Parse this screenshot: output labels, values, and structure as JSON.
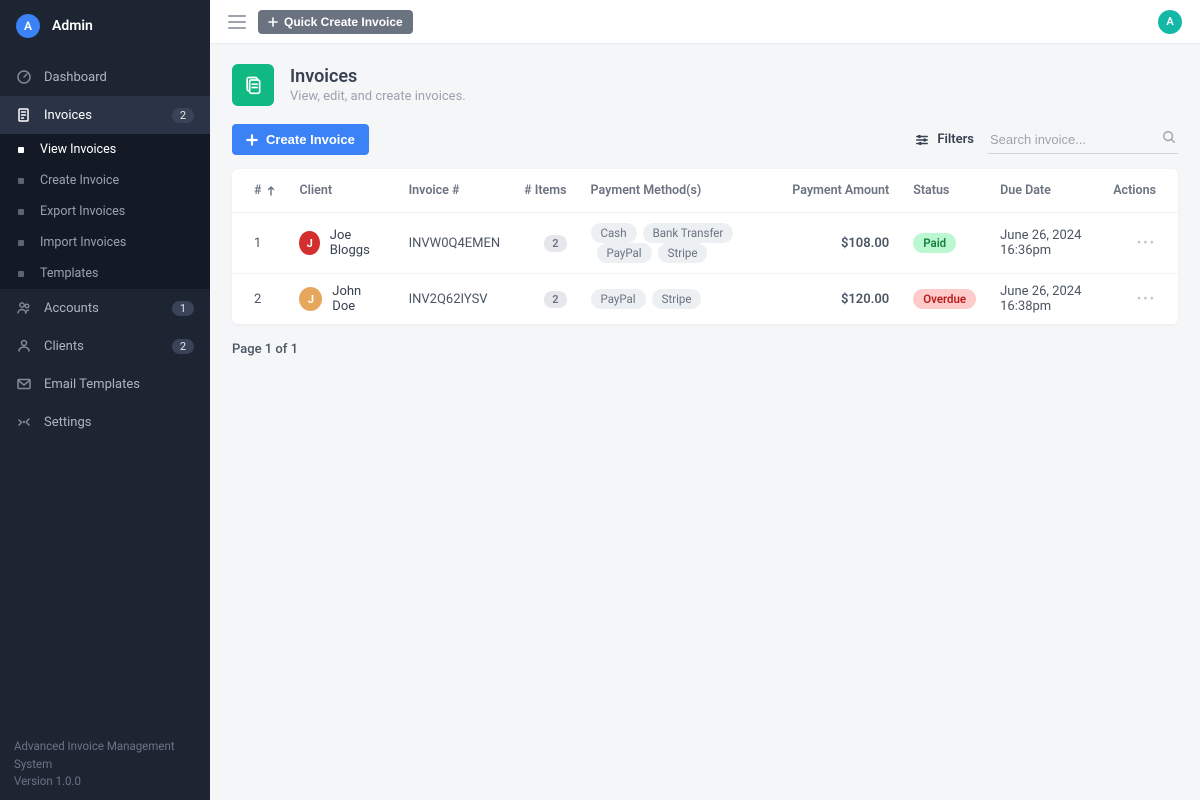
{
  "sidebar": {
    "brand_initial": "A",
    "brand_name": "Admin",
    "items": [
      {
        "label": "Dashboard",
        "count": null,
        "active": false
      },
      {
        "label": "Invoices",
        "count": "2",
        "active": true,
        "sub": [
          {
            "label": "View Invoices",
            "active": true
          },
          {
            "label": "Create Invoice",
            "active": false
          },
          {
            "label": "Export Invoices",
            "active": false
          },
          {
            "label": "Import Invoices",
            "active": false
          },
          {
            "label": "Templates",
            "active": false
          }
        ]
      },
      {
        "label": "Accounts",
        "count": "1",
        "active": false
      },
      {
        "label": "Clients",
        "count": "2",
        "active": false
      },
      {
        "label": "Email Templates",
        "count": null,
        "active": false
      },
      {
        "label": "Settings",
        "count": null,
        "active": false
      }
    ],
    "footer_line1": "Advanced Invoice Management System",
    "footer_line2": "Version 1.0.0"
  },
  "topbar": {
    "quick_create_label": "Quick Create Invoice",
    "avatar_initial": "A"
  },
  "page": {
    "title": "Invoices",
    "subtitle": "View, edit, and create invoices.",
    "create_button": "Create Invoice",
    "filters_label": "Filters",
    "search_placeholder": "Search invoice..."
  },
  "table": {
    "headers": {
      "idx": "#",
      "client": "Client",
      "invoice_no": "Invoice #",
      "items": "# Items",
      "methods": "Payment Method(s)",
      "amount": "Payment Amount",
      "status": "Status",
      "due": "Due Date",
      "actions": "Actions"
    },
    "rows": [
      {
        "idx": "1",
        "client_initial": "J",
        "client_name": "Joe Bloggs",
        "client_color": "#d32f2f",
        "invoice_no": "INVW0Q4EMEN",
        "items": "2",
        "methods": [
          "Cash",
          "Bank Transfer",
          "PayPal",
          "Stripe"
        ],
        "amount": "$108.00",
        "status": "Paid",
        "status_class": "paid",
        "due": "June 26, 2024 16:36pm"
      },
      {
        "idx": "2",
        "client_initial": "J",
        "client_name": "John Doe",
        "client_color": "#e6a75c",
        "invoice_no": "INV2Q62IYSV",
        "items": "2",
        "methods": [
          "PayPal",
          "Stripe"
        ],
        "amount": "$120.00",
        "status": "Overdue",
        "status_class": "overdue",
        "due": "June 26, 2024 16:38pm"
      }
    ]
  },
  "pagination": "Page 1 of 1"
}
